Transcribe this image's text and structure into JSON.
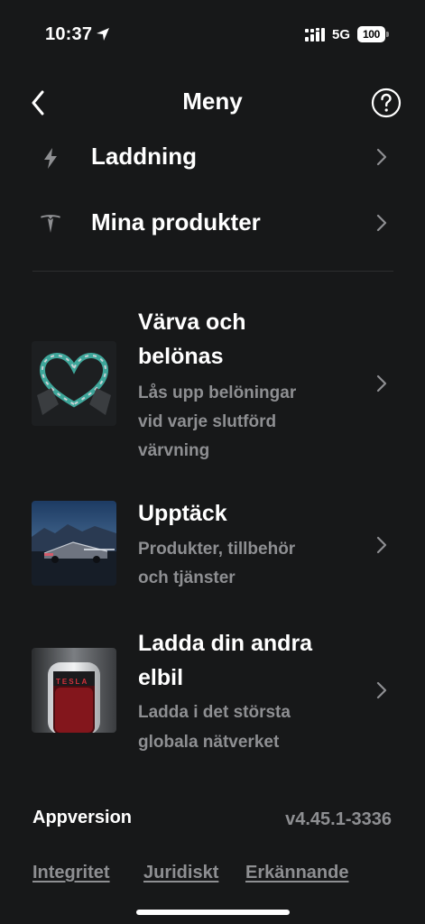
{
  "status_bar": {
    "time": "10:37",
    "network": "5G",
    "battery": "100"
  },
  "header": {
    "title": "Meny"
  },
  "menu": [
    {
      "label": "Laddning",
      "icon": "lightning-icon"
    },
    {
      "label": "Mina produkter",
      "icon": "tesla-logo-icon"
    }
  ],
  "promos": [
    {
      "title_line1": "Värva och",
      "title_line2": "belönas",
      "sub_line1": "Lås upp belöningar",
      "sub_line2": "vid varje slutförd",
      "sub_line3": "värvning"
    },
    {
      "title_line1": "Upptäck",
      "sub_line1": "Produkter, tillbehör",
      "sub_line2": "och tjänster"
    },
    {
      "title_line1": "Ladda din andra",
      "title_line2": "elbil",
      "sub_line1": "Ladda i det största",
      "sub_line2": "globala nätverket",
      "charger_brand": "TESLA"
    }
  ],
  "footer": {
    "version_label": "Appversion",
    "version_value": "v4.45.1-3336",
    "links": [
      "Integritet",
      "Juridiskt",
      "Erkännande"
    ]
  }
}
